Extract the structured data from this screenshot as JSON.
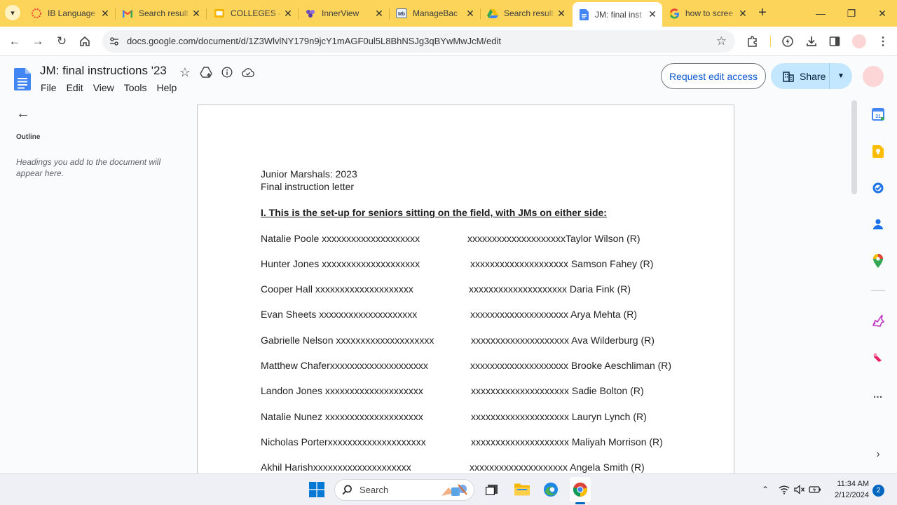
{
  "browser": {
    "tabs": [
      {
        "title": "IB Language",
        "icon": "ib-logo-icon"
      },
      {
        "title": "Search result",
        "icon": "gmail-icon"
      },
      {
        "title": "COLLEGES - ",
        "icon": "google-slides-icon"
      },
      {
        "title": "InnerView",
        "icon": "innerview-icon"
      },
      {
        "title": "ManageBac",
        "icon": "managebac-icon"
      },
      {
        "title": "Search result",
        "icon": "google-drive-icon"
      },
      {
        "title": "JM: final inst",
        "icon": "google-docs-icon",
        "active": true
      },
      {
        "title": "how to scree",
        "icon": "google-icon"
      }
    ],
    "url": "docs.google.com/document/d/1Z3WlvlNY179n9jcY1mAGF0ul5L8BhNSJg3qBYwMwJcM/edit",
    "accent": "#fcd45a"
  },
  "doc": {
    "title": "JM: final instructions '23",
    "menu": [
      "File",
      "Edit",
      "View",
      "Tools",
      "Help"
    ],
    "request_edit_label": "Request edit access",
    "share_label": "Share"
  },
  "outline": {
    "title": "Outline",
    "hint": "Headings you add to the document will appear here."
  },
  "content": {
    "line1": "Junior Marshals: 2023",
    "line2": "Final instruction letter",
    "heading": "I. This is the set-up for seniors sitting on the field, with JMs on either side:",
    "rows": [
      {
        "left": "Natalie Poole xxxxxxxxxxxxxxxxxxxx",
        "right": "xxxxxxxxxxxxxxxxxxxxTaylor Wilson (R)"
      },
      {
        "left": "Hunter Jones xxxxxxxxxxxxxxxxxxxx",
        "right": "xxxxxxxxxxxxxxxxxxxx Samson Fahey (R)"
      },
      {
        "left": "Cooper Hall xxxxxxxxxxxxxxxxxxxx",
        "right": "xxxxxxxxxxxxxxxxxxxx Daria Fink (R)"
      },
      {
        "left": "Evan Sheets xxxxxxxxxxxxxxxxxxxx",
        "right": "xxxxxxxxxxxxxxxxxxxx Arya Mehta (R)"
      },
      {
        "left": "Gabrielle Nelson xxxxxxxxxxxxxxxxxxxx",
        "right": "xxxxxxxxxxxxxxxxxxxx Ava Wilderburg (R)"
      },
      {
        "left": "Matthew Chaferxxxxxxxxxxxxxxxxxxxx",
        "right": "xxxxxxxxxxxxxxxxxxxx Brooke Aeschliman (R)"
      },
      {
        "left": "Landon Jones xxxxxxxxxxxxxxxxxxxx",
        "right": "xxxxxxxxxxxxxxxxxxxx Sadie Bolton (R)"
      },
      {
        "left": "Natalie Nunez xxxxxxxxxxxxxxxxxxxx",
        "right": "xxxxxxxxxxxxxxxxxxxx Lauryn Lynch (R)"
      },
      {
        "left": "Nicholas Porterxxxxxxxxxxxxxxxxxxxx",
        "right": "xxxxxxxxxxxxxxxxxxxx Maliyah Morrison (R)"
      },
      {
        "left": "Akhil Harishxxxxxxxxxxxxxxxxxxxx",
        "right": "xxxxxxxxxxxxxxxxxxxx Angela Smith (R)"
      }
    ]
  },
  "taskbar": {
    "search_label": "Search",
    "time": "11:34 AM",
    "date": "2/12/2024",
    "notifications": "2"
  }
}
